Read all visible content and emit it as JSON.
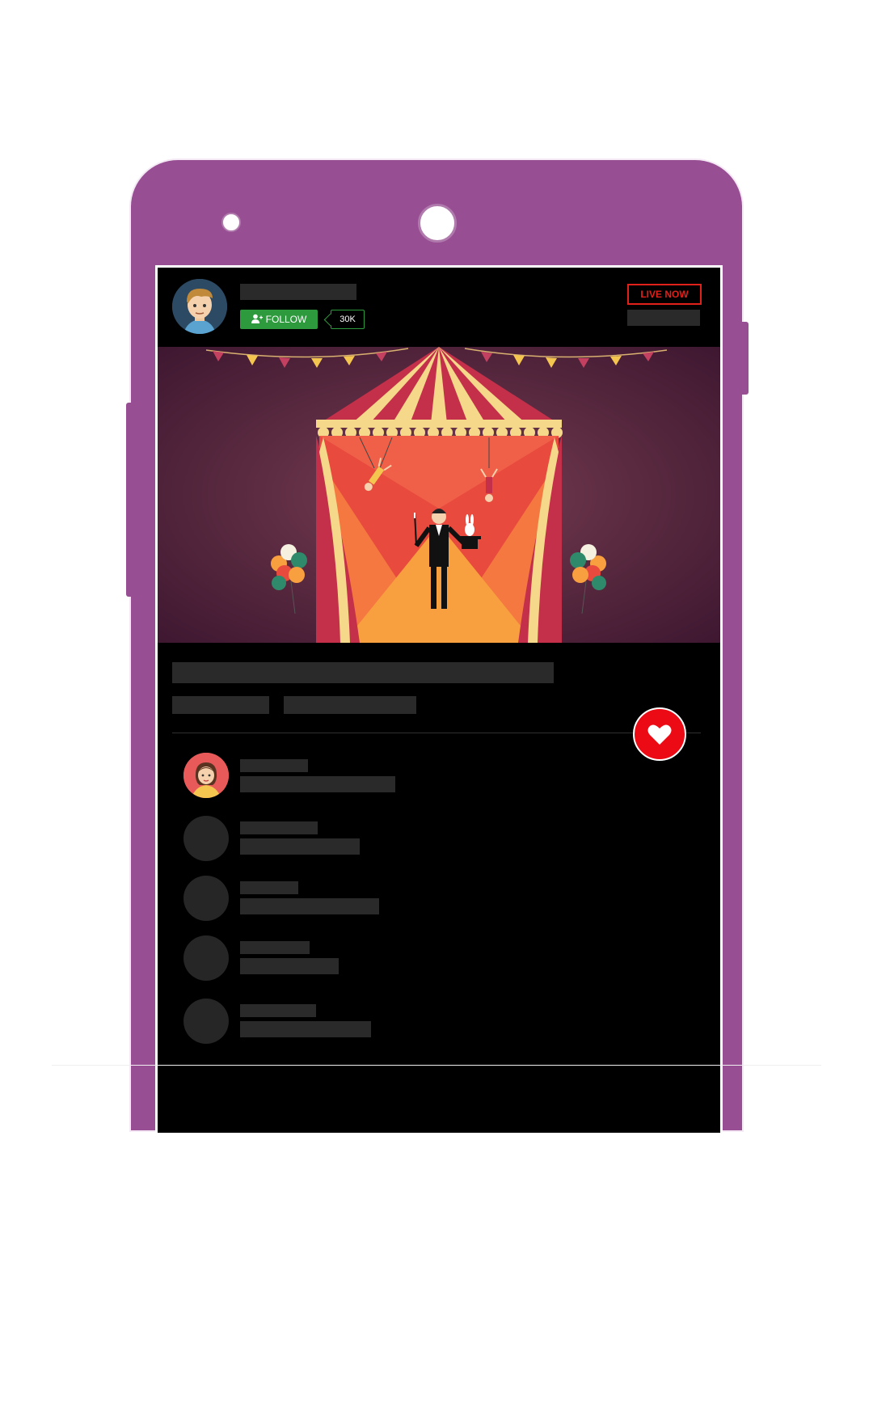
{
  "header": {
    "follow_label": "FOLLOW",
    "follow_count": "30K",
    "live_label": "LIVE NOW"
  },
  "icons": {
    "follow": "add-user-icon",
    "like": "heart-icon"
  },
  "colors": {
    "phone": "#974e93",
    "follow": "#2e9a3e",
    "live": "#e0201a",
    "like": "#ec0a14"
  }
}
